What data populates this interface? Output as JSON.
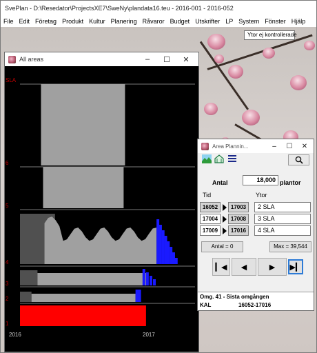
{
  "app": {
    "title": "SvePlan - D:\\Resedator\\ProjectsXE7\\SweNy\\plandata16.teu - 2016-001 - 2016-052",
    "menu": [
      "File",
      "Edit",
      "Företag",
      "Produkt",
      "Kultur",
      "Planering",
      "Råvaror",
      "Budget",
      "Utskrifter",
      "LP",
      "System",
      "Fönster",
      "Hjälp"
    ],
    "tooltip": "Ytor ej kontrollerade",
    "colors": {
      "chart_bg": "#000000",
      "light_gray": "#a0a0a0",
      "dark_gray": "#505050",
      "blue": "#1a1aff",
      "red": "#ff0000",
      "label_red": "#c00000"
    }
  },
  "all_areas": {
    "title": "All areas",
    "chart_data": {
      "type": "area",
      "x_start_label": "2016",
      "x_end_label": "2017",
      "rows": [
        {
          "label": "SLA",
          "light_gray": [
            0.12,
            0.6
          ]
        },
        {
          "label": "6",
          "light_gray": [
            0.12,
            0.6
          ]
        },
        {
          "label": "5",
          "light_gray": [
            0.12,
            0.6
          ]
        },
        {
          "label": "4",
          "dark_gray": [
            0,
            0.2
          ],
          "light_gray": [
            0.18,
            0.78
          ],
          "blue": [
            0.78,
            0.9
          ]
        },
        {
          "label": "3",
          "dark_gray": [
            0,
            0.1
          ],
          "light_gray": [
            0.1,
            0.72
          ],
          "blue": [
            0.7,
            0.78
          ]
        },
        {
          "label": "2",
          "dark_gray": [
            0,
            0.05
          ],
          "light_gray": [
            0.05,
            0.66
          ],
          "blue": [
            0.66,
            0.72
          ]
        },
        {
          "label": "1",
          "red": [
            0,
            0.72
          ]
        }
      ]
    }
  },
  "area_planning": {
    "title": "Area Plannin...",
    "antal_label": "Antal",
    "antal_value": "18,000",
    "plantor_label": "plantor",
    "tid_label": "Tid",
    "ytor_label": "Ytor",
    "rows": [
      {
        "from": "16052",
        "to": "17003",
        "yta": "2  SLA"
      },
      {
        "from": "17004",
        "to": "17008",
        "yta": "3  SLA"
      },
      {
        "from": "17009",
        "to": "17016",
        "yta": "4  SLA"
      }
    ],
    "antal_btn": "Antal = 0",
    "max_btn": "Max = 39,544",
    "status_line1": "Omg. 41  -  Sista omgången",
    "status_kal": "KAL",
    "status_range": "16052-17016"
  }
}
